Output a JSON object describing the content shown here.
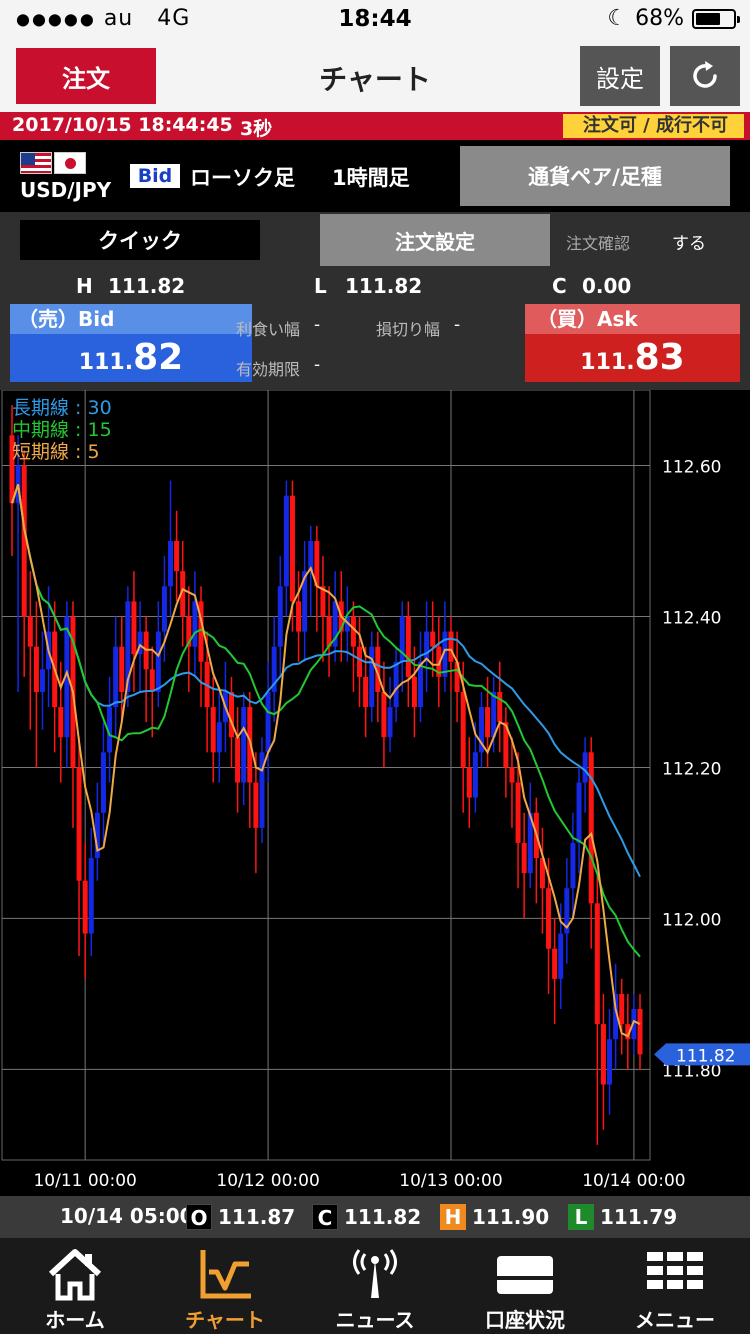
{
  "status_bar": {
    "signal": "●●●●●",
    "carrier": "au",
    "network": "4G",
    "time": "18:44",
    "battery": "68%",
    "battery_level": 0.68
  },
  "nav": {
    "order_button": "注文",
    "title": "チャート",
    "settings_button": "設定",
    "refresh_icon": "refresh-icon"
  },
  "info_bar": {
    "datetime": "2017/10/15 18:44:45",
    "interval": "3秒",
    "status": "注文可 / 成行不可"
  },
  "currency": {
    "pair": "USD/JPY",
    "price_type": "Bid",
    "chart_type": "ローソク足",
    "timeframe": "1時間足",
    "pair_button": "通貨ペア/足種"
  },
  "order_row": {
    "quick_button": "クイック",
    "order_setting_button": "注文設定",
    "confirm_label": "注文確認",
    "confirm_value": "する"
  },
  "prices": {
    "high_label": "H",
    "high": "111.82",
    "low_label": "L",
    "low": "111.82",
    "change_label": "C",
    "change": "0.00",
    "bid_label": "（売）Bid",
    "bid_small": "111.",
    "bid_big": "82",
    "ask_label": "（買）Ask",
    "ask_small": "111.",
    "ask_big": "83",
    "take_profit_label": "利食い幅",
    "take_profit": "-",
    "stop_loss_label": "損切り幅",
    "stop_loss": "-",
    "expiry_label": "有効期限",
    "expiry": "-"
  },
  "chart_data": {
    "type": "candlestick",
    "legend": [
      {
        "name": "長期線",
        "value": "30",
        "color": "#2e9be6"
      },
      {
        "name": "中期線",
        "value": "15",
        "color": "#22c832"
      },
      {
        "name": "短期線",
        "value": "5",
        "color": "#f0a848"
      }
    ],
    "y_ticks": [
      "112.60",
      "112.40",
      "112.20",
      "112.00",
      "111.80"
    ],
    "y_tick_values": [
      112.6,
      112.4,
      112.2,
      112.0,
      111.8
    ],
    "ylim": [
      111.68,
      112.7
    ],
    "x_ticks": [
      "10/11 00:00",
      "10/12 00:00",
      "10/13 00:00",
      "10/14 00:00"
    ],
    "x_tick_index": [
      12,
      42,
      72,
      102
    ],
    "current_price_label": "111.82",
    "current_price": 111.82,
    "candles": [
      [
        112.64,
        112.55,
        112.68,
        112.48
      ],
      [
        112.55,
        112.6,
        112.64,
        112.3
      ],
      [
        112.6,
        112.4,
        112.62,
        112.32
      ],
      [
        112.4,
        112.36,
        112.46,
        112.25
      ],
      [
        112.36,
        112.3,
        112.42,
        112.2
      ],
      [
        112.3,
        112.33,
        112.38,
        112.25
      ],
      [
        112.33,
        112.38,
        112.44,
        112.28
      ],
      [
        112.38,
        112.28,
        112.42,
        112.22
      ],
      [
        112.28,
        112.24,
        112.34,
        112.18
      ],
      [
        112.24,
        112.4,
        112.42,
        112.2
      ],
      [
        112.4,
        112.2,
        112.42,
        112.12
      ],
      [
        112.2,
        112.05,
        112.24,
        111.95
      ],
      [
        112.05,
        111.98,
        112.1,
        111.92
      ],
      [
        111.98,
        112.08,
        112.12,
        111.95
      ],
      [
        112.08,
        112.14,
        112.18,
        112.05
      ],
      [
        112.14,
        112.22,
        112.26,
        112.1
      ],
      [
        112.22,
        112.28,
        112.32,
        112.18
      ],
      [
        112.28,
        112.36,
        112.4,
        112.24
      ],
      [
        112.36,
        112.3,
        112.4,
        112.26
      ],
      [
        112.3,
        112.42,
        112.44,
        112.28
      ],
      [
        112.42,
        112.35,
        112.46,
        112.3
      ],
      [
        112.35,
        112.38,
        112.42,
        112.3
      ],
      [
        112.38,
        112.33,
        112.4,
        112.26
      ],
      [
        112.33,
        112.3,
        112.36,
        112.24
      ],
      [
        112.3,
        112.38,
        112.42,
        112.28
      ],
      [
        112.38,
        112.44,
        112.48,
        112.34
      ],
      [
        112.44,
        112.5,
        112.58,
        112.4
      ],
      [
        112.5,
        112.46,
        112.54,
        112.42
      ],
      [
        112.46,
        112.4,
        112.5,
        112.36
      ],
      [
        112.4,
        112.36,
        112.44,
        112.3
      ],
      [
        112.36,
        112.42,
        112.46,
        112.32
      ],
      [
        112.42,
        112.34,
        112.44,
        112.28
      ],
      [
        112.34,
        112.28,
        112.38,
        112.22
      ],
      [
        112.28,
        112.22,
        112.32,
        112.18
      ],
      [
        112.22,
        112.26,
        112.3,
        112.18
      ],
      [
        112.26,
        112.3,
        112.34,
        112.22
      ],
      [
        112.3,
        112.24,
        112.32,
        112.2
      ],
      [
        112.24,
        112.18,
        112.28,
        112.14
      ],
      [
        112.18,
        112.28,
        112.3,
        112.15
      ],
      [
        112.28,
        112.18,
        112.3,
        112.12
      ],
      [
        112.18,
        112.12,
        112.22,
        112.06
      ],
      [
        112.12,
        112.22,
        112.24,
        112.1
      ],
      [
        112.22,
        112.3,
        112.34,
        112.18
      ],
      [
        112.3,
        112.36,
        112.4,
        112.26
      ],
      [
        112.36,
        112.44,
        112.48,
        112.32
      ],
      [
        112.44,
        112.56,
        112.58,
        112.4
      ],
      [
        112.56,
        112.42,
        112.58,
        112.38
      ],
      [
        112.42,
        112.38,
        112.46,
        112.34
      ],
      [
        112.38,
        112.46,
        112.5,
        112.34
      ],
      [
        112.46,
        112.5,
        112.52,
        112.4
      ],
      [
        112.5,
        112.44,
        112.52,
        112.38
      ],
      [
        112.44,
        112.4,
        112.48,
        112.34
      ],
      [
        112.4,
        112.36,
        112.44,
        112.32
      ],
      [
        112.36,
        112.42,
        112.46,
        112.34
      ],
      [
        112.42,
        112.38,
        112.46,
        112.34
      ],
      [
        112.38,
        112.4,
        112.44,
        112.34
      ],
      [
        112.4,
        112.36,
        112.42,
        112.3
      ],
      [
        112.36,
        112.32,
        112.4,
        112.28
      ],
      [
        112.32,
        112.28,
        112.36,
        112.24
      ],
      [
        112.28,
        112.36,
        112.38,
        112.26
      ],
      [
        112.36,
        112.3,
        112.38,
        112.26
      ],
      [
        112.3,
        112.24,
        112.34,
        112.2
      ],
      [
        112.24,
        112.28,
        112.32,
        112.22
      ],
      [
        112.28,
        112.34,
        112.36,
        112.26
      ],
      [
        112.34,
        112.4,
        112.42,
        112.3
      ],
      [
        112.4,
        112.32,
        112.42,
        112.28
      ],
      [
        112.32,
        112.28,
        112.36,
        112.24
      ],
      [
        112.28,
        112.34,
        112.38,
        112.26
      ],
      [
        112.34,
        112.38,
        112.42,
        112.3
      ],
      [
        112.38,
        112.36,
        112.42,
        112.32
      ],
      [
        112.36,
        112.32,
        112.4,
        112.28
      ],
      [
        112.32,
        112.38,
        112.42,
        112.3
      ],
      [
        112.38,
        112.34,
        112.4,
        112.3
      ],
      [
        112.34,
        112.3,
        112.38,
        112.26
      ],
      [
        112.3,
        112.2,
        112.34,
        112.14
      ],
      [
        112.2,
        112.16,
        112.24,
        112.12
      ],
      [
        112.16,
        112.22,
        112.26,
        112.14
      ],
      [
        112.22,
        112.28,
        112.3,
        112.2
      ],
      [
        112.28,
        112.24,
        112.32,
        112.2
      ],
      [
        112.24,
        112.3,
        112.32,
        112.22
      ],
      [
        112.3,
        112.26,
        112.34,
        112.22
      ],
      [
        112.26,
        112.2,
        112.28,
        112.16
      ],
      [
        112.2,
        112.18,
        112.24,
        112.12
      ],
      [
        112.18,
        112.1,
        112.22,
        112.04
      ],
      [
        112.1,
        112.06,
        112.14,
        112.0
      ],
      [
        112.06,
        112.14,
        112.18,
        112.04
      ],
      [
        112.14,
        112.08,
        112.16,
        112.02
      ],
      [
        112.08,
        112.04,
        112.12,
        111.98
      ],
      [
        112.04,
        111.96,
        112.08,
        111.9
      ],
      [
        111.96,
        111.92,
        112.0,
        111.86
      ],
      [
        111.92,
        111.98,
        112.02,
        111.88
      ],
      [
        111.98,
        112.04,
        112.08,
        111.94
      ],
      [
        112.04,
        112.1,
        112.14,
        112.0
      ],
      [
        112.1,
        112.18,
        112.2,
        112.06
      ],
      [
        112.18,
        112.22,
        112.24,
        112.14
      ],
      [
        112.22,
        112.02,
        112.24,
        111.96
      ],
      [
        112.02,
        111.86,
        112.06,
        111.7
      ],
      [
        111.86,
        111.78,
        111.9,
        111.72
      ],
      [
        111.78,
        111.84,
        111.88,
        111.74
      ],
      [
        111.84,
        111.9,
        111.94,
        111.8
      ],
      [
        111.9,
        111.86,
        111.92,
        111.82
      ],
      [
        111.86,
        111.84,
        111.9,
        111.8
      ],
      [
        111.84,
        111.88,
        111.9,
        111.82
      ],
      [
        111.88,
        111.82,
        111.9,
        111.8
      ]
    ]
  },
  "ohlc_bar": {
    "time": "10/14 05:00",
    "o_label": "O",
    "open": "111.87",
    "c_label": "C",
    "close": "111.82",
    "h_label": "H",
    "high": "111.90",
    "l_label": "L",
    "low": "111.79"
  },
  "tabs": [
    {
      "label": "ホーム",
      "icon": "home-icon",
      "active": false
    },
    {
      "label": "チャート",
      "icon": "chart-icon",
      "active": true
    },
    {
      "label": "ニュース",
      "icon": "news-tower-icon",
      "active": false
    },
    {
      "label": "口座状況",
      "icon": "card-icon",
      "active": false
    },
    {
      "label": "メニュー",
      "icon": "menu-grid-icon",
      "active": false
    }
  ],
  "colors": {
    "brand_red": "#c8102e",
    "bid_blue": "#2a62dd",
    "ask_red": "#cf2020",
    "candle_up": "#1428e6",
    "candle_down": "#ff1414",
    "accent_orange": "#f0a030"
  }
}
